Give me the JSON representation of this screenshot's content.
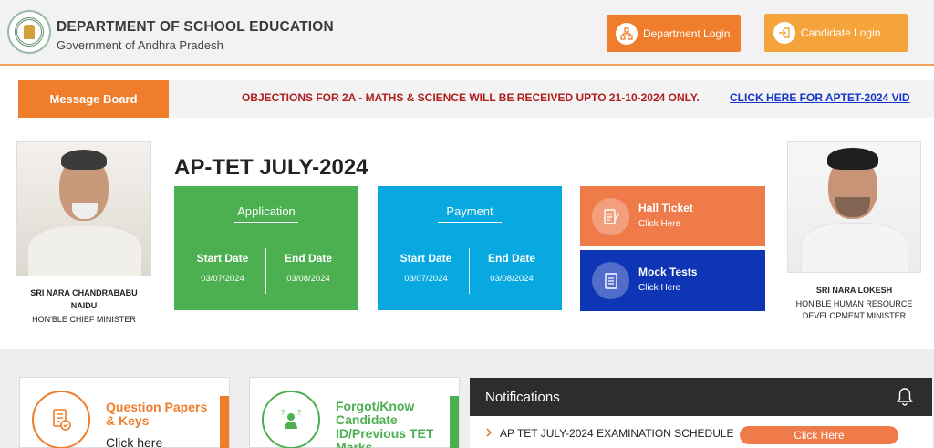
{
  "header": {
    "title": "DEPARTMENT OF SCHOOL EDUCATION",
    "subtitle": "Government of Andhra Pradesh",
    "department_login": "Department Login",
    "candidate_login": "Candidate Login"
  },
  "message_board": {
    "label": "Message Board",
    "text": "OBJECTIONS FOR 2A - MATHS & SCIENCE WILL BE RECEIVED UPTO 21-10-2024 ONLY.",
    "link": "CLICK HERE FOR APTET-2024 VID"
  },
  "leaders": {
    "left": {
      "name_line1": "SRI NARA CHANDRABABU",
      "name_line2": "NAIDU",
      "role": "HON'BLE CHIEF MINISTER"
    },
    "right": {
      "name": "SRI NARA LOKESH",
      "role_line1": "HON'BLE HUMAN RESOURCE",
      "role_line2": "DEVELOPMENT MINISTER"
    }
  },
  "page_title": "AP-TET JULY-2024",
  "cards": {
    "application": {
      "title": "Application",
      "start_label": "Start Date",
      "start_value": "03/07/2024",
      "end_label": "End Date",
      "end_value": "03/08/2024"
    },
    "payment": {
      "title": "Payment",
      "start_label": "Start Date",
      "start_value": "03/07/2024",
      "end_label": "End Date",
      "end_value": "03/08/2024"
    }
  },
  "tiles": {
    "hall_ticket": {
      "title": "Hall Ticket",
      "sub": "Click Here"
    },
    "mock_tests": {
      "title": "Mock Tests",
      "sub": "Click Here"
    }
  },
  "boxes": {
    "question_papers": {
      "title": "Question Papers & Keys",
      "click": "Click here"
    },
    "forgot_id": {
      "title": "Forgot/Know Candidate ID/Previous TET Marks"
    }
  },
  "notifications": {
    "title": "Notifications",
    "items": [
      {
        "text": "AP TET JULY-2024 EXAMINATION SCHEDULE",
        "button": "Click Here"
      }
    ]
  },
  "colors": {
    "orange": "#ef7d2b",
    "green": "#4caf50",
    "blue": "#07a9e0",
    "navy": "#0e35b5",
    "coral": "#ef7b4b"
  },
  "icons": [
    "emblem-icon",
    "department-login-icon",
    "candidate-login-icon",
    "hall-ticket-icon",
    "mock-tests-icon",
    "question-papers-icon",
    "forgot-id-icon",
    "bell-icon",
    "chevron-right-icon"
  ]
}
